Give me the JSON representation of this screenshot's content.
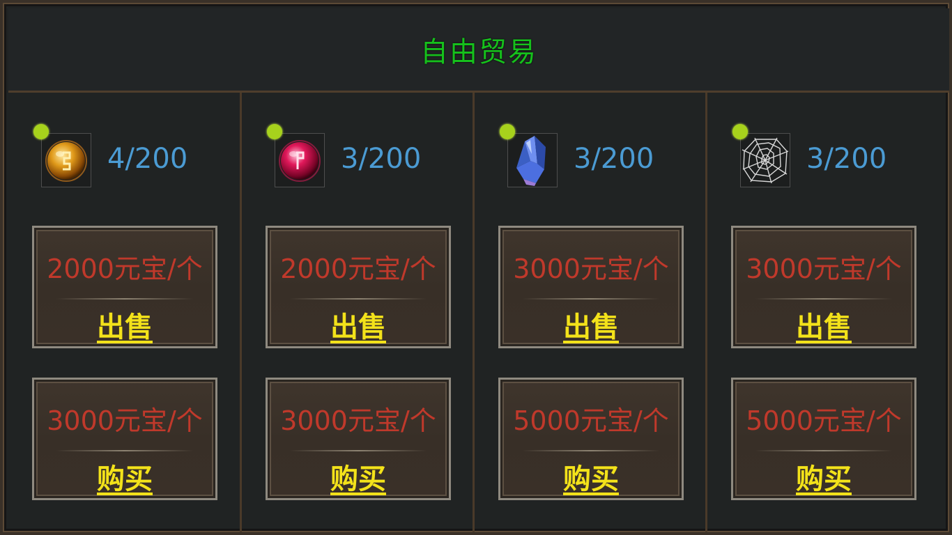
{
  "title": "自由贸易",
  "colors": {
    "title": "#16c01c",
    "count": "#4b9bd3",
    "price": "#c0392b",
    "action": "#f3e21a",
    "status_dot": "#a7d21c"
  },
  "items": [
    {
      "icon": "gold-rune-orb-icon",
      "count": "4/200",
      "sell_price": "2000元宝/个",
      "sell_label": "出售",
      "buy_price": "3000元宝/个",
      "buy_label": "购买"
    },
    {
      "icon": "red-rune-orb-icon",
      "count": "3/200",
      "sell_price": "2000元宝/个",
      "sell_label": "出售",
      "buy_price": "3000元宝/个",
      "buy_label": "购买"
    },
    {
      "icon": "blue-crystal-icon",
      "count": "3/200",
      "sell_price": "3000元宝/个",
      "sell_label": "出售",
      "buy_price": "5000元宝/个",
      "buy_label": "购买"
    },
    {
      "icon": "spider-web-icon",
      "count": "3/200",
      "sell_price": "3000元宝/个",
      "sell_label": "出售",
      "buy_price": "5000元宝/个",
      "buy_label": "购买"
    }
  ]
}
